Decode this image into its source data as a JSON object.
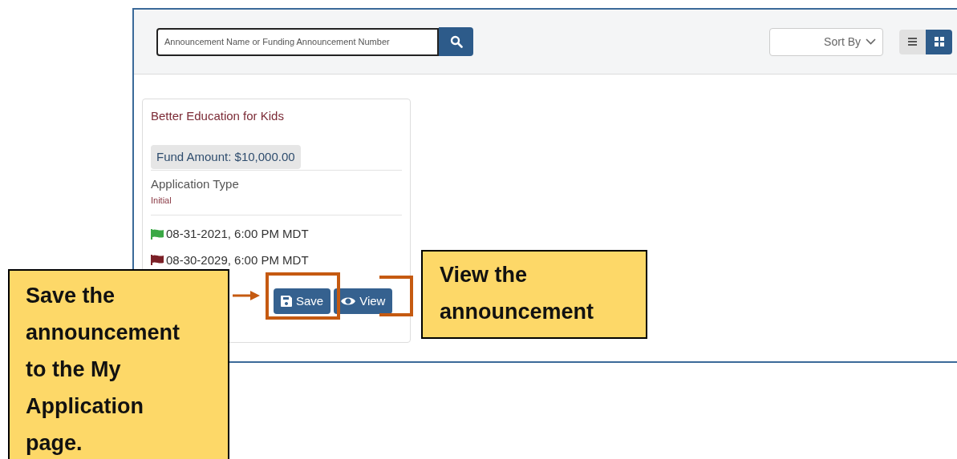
{
  "toolbar": {
    "search": {
      "placeholder": "Announcement Name or Funding Announcement Number"
    },
    "sort": {
      "label": "Sort By"
    },
    "view_toggles": [
      {
        "kind": "list",
        "selected": false
      },
      {
        "kind": "grid",
        "selected": true
      }
    ]
  },
  "card": {
    "title": "Better Education for Kids",
    "fund_amount": "Fund Amount: $10,000.00",
    "application_type_label": "Application Type",
    "application_type_value": "Initial",
    "dates": [
      {
        "text": "08-31-2021, 6:00 PM MDT",
        "color": "#3aa845"
      },
      {
        "text": "08-30-2029, 6:00 PM MDT",
        "color": "#7b2027"
      }
    ],
    "buttons": [
      {
        "kind": "save",
        "label": "Save"
      },
      {
        "kind": "view",
        "label": "View"
      }
    ]
  },
  "callouts": [
    {
      "kind": "save",
      "text": "Save the announcement to the My Application page."
    },
    {
      "kind": "view",
      "text": "View the announcement"
    }
  ]
}
